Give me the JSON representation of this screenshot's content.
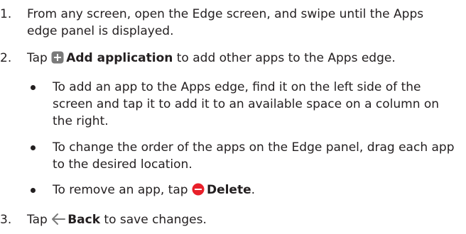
{
  "steps": [
    {
      "num": "1.",
      "text": "From any screen, open the Edge screen, and swipe until the Apps edge panel is displayed."
    },
    {
      "num": "2.",
      "prefix": "Tap",
      "icon": "add-square-icon",
      "bold": "Add application",
      "suffix": "to add other apps to the Apps edge.",
      "bullets": [
        {
          "text": "To add an app to the Apps edge, find it on the left side of the screen and tap it to add it to an available space on a column on the right."
        },
        {
          "text": "To change the order of the apps on the Edge panel, drag each app to the desired location."
        },
        {
          "prefix": "To remove an app, tap",
          "icon": "minus-circle-icon",
          "bold": "Delete",
          "suffix": "."
        }
      ]
    },
    {
      "num": "3.",
      "prefix": "Tap",
      "icon": "back-arrow-icon",
      "bold": "Back",
      "suffix": "to save changes."
    }
  ],
  "colors": {
    "text": "#231f20",
    "icon_gray": "#7a7a7a",
    "delete_red": "#e8202a"
  }
}
